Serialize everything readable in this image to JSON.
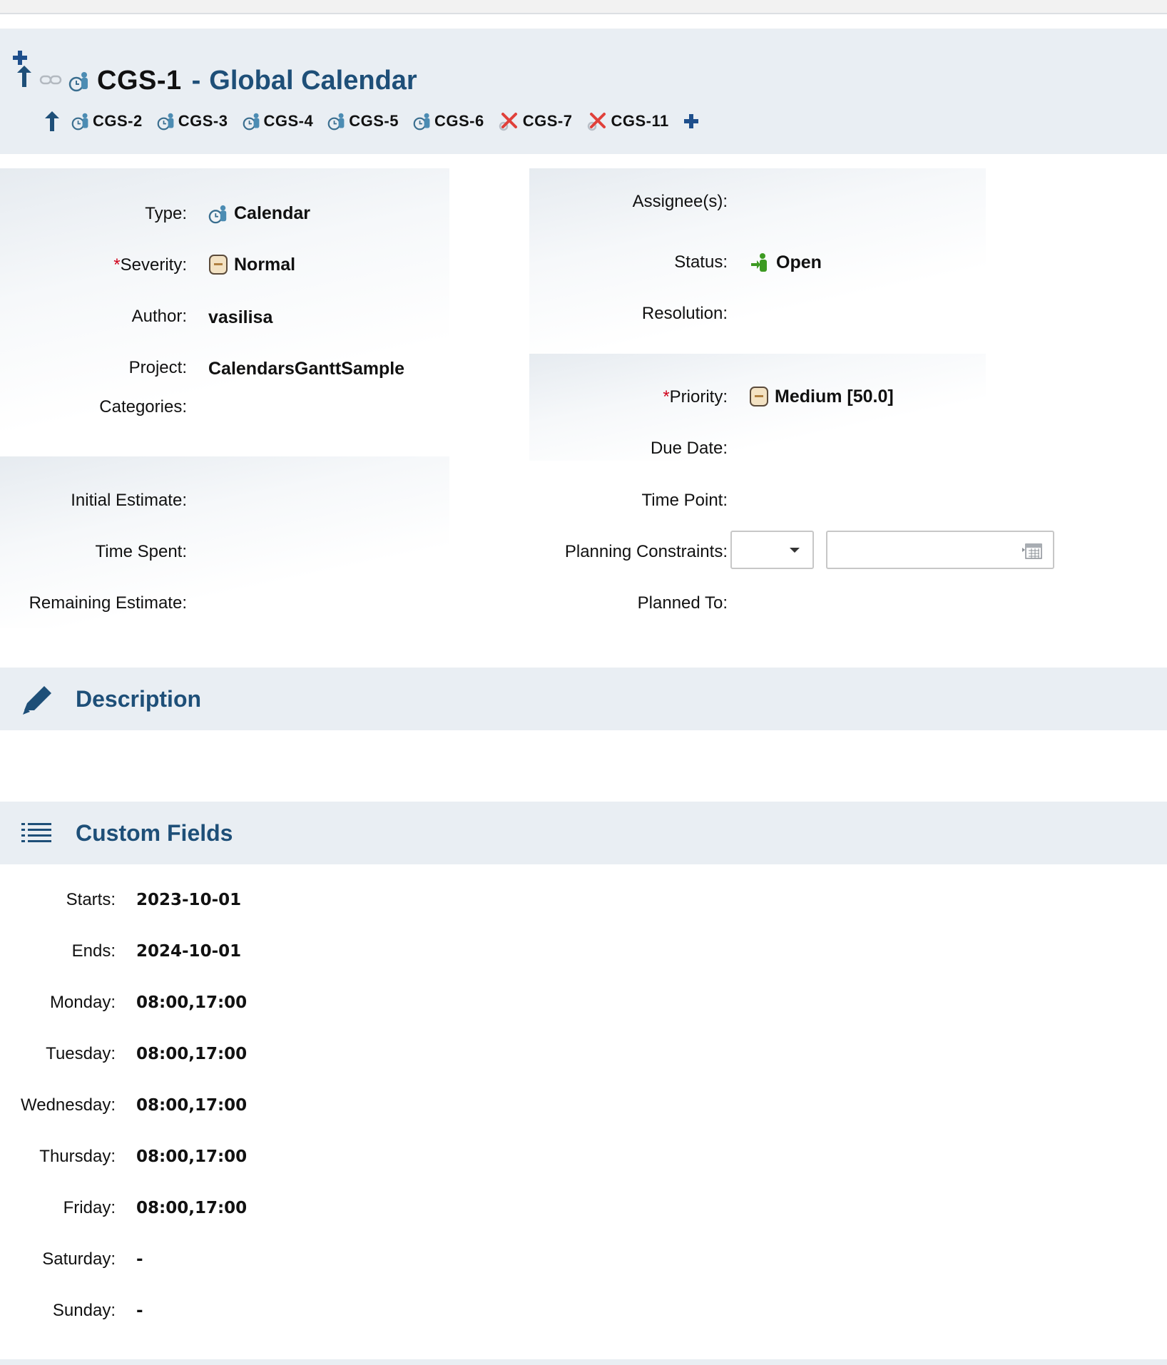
{
  "header": {
    "key": "CGS-1",
    "separator": "-",
    "title": "Global Calendar",
    "children": [
      {
        "key": "CGS-2",
        "icon": "calendar-type-icon"
      },
      {
        "key": "CGS-3",
        "icon": "calendar-type-icon"
      },
      {
        "key": "CGS-4",
        "icon": "calendar-type-icon"
      },
      {
        "key": "CGS-5",
        "icon": "calendar-type-icon"
      },
      {
        "key": "CGS-6",
        "icon": "calendar-type-icon"
      },
      {
        "key": "CGS-7",
        "icon": "wrench-x-icon"
      },
      {
        "key": "CGS-11",
        "icon": "wrench-x-icon"
      }
    ]
  },
  "fields_left": {
    "type_label": "Type:",
    "type_value": "Calendar",
    "severity_req": "*",
    "severity_label": "Severity:",
    "severity_value": "Normal",
    "author_label": "Author:",
    "author_value": "vasilisa",
    "project_label": "Project:",
    "project_value": "CalendarsGanttSample",
    "categories_label": "Categories:",
    "initial_estimate_label": "Initial Estimate:",
    "time_spent_label": "Time Spent:",
    "remaining_estimate_label": "Remaining Estimate:"
  },
  "fields_right": {
    "assignees_label": "Assignee(s):",
    "status_label": "Status:",
    "status_value": "Open",
    "resolution_label": "Resolution:",
    "priority_req": "*",
    "priority_label": "Priority:",
    "priority_value": "Medium [50.0]",
    "due_date_label": "Due Date:",
    "time_point_label": "Time Point:",
    "planning_constraints_label": "Planning Constraints:",
    "planned_to_label": "Planned To:"
  },
  "description": {
    "title": "Description"
  },
  "custom_fields": {
    "title": "Custom Fields",
    "rows": [
      {
        "label": "Starts:",
        "value": "2023-10-01"
      },
      {
        "label": "Ends:",
        "value": "2024-10-01"
      },
      {
        "label": "Monday:",
        "value": "08:00,17:00"
      },
      {
        "label": "Tuesday:",
        "value": "08:00,17:00"
      },
      {
        "label": "Wednesday:",
        "value": "08:00,17:00"
      },
      {
        "label": "Thursday:",
        "value": "08:00,17:00"
      },
      {
        "label": "Friday:",
        "value": "08:00,17:00"
      },
      {
        "label": "Saturday:",
        "value": "-"
      },
      {
        "label": "Sunday:",
        "value": "-"
      }
    ]
  },
  "colors": {
    "accent": "#1e4f78",
    "section_bg": "#e9eef3",
    "required": "#d0021b",
    "status_green": "#3d9a22"
  }
}
